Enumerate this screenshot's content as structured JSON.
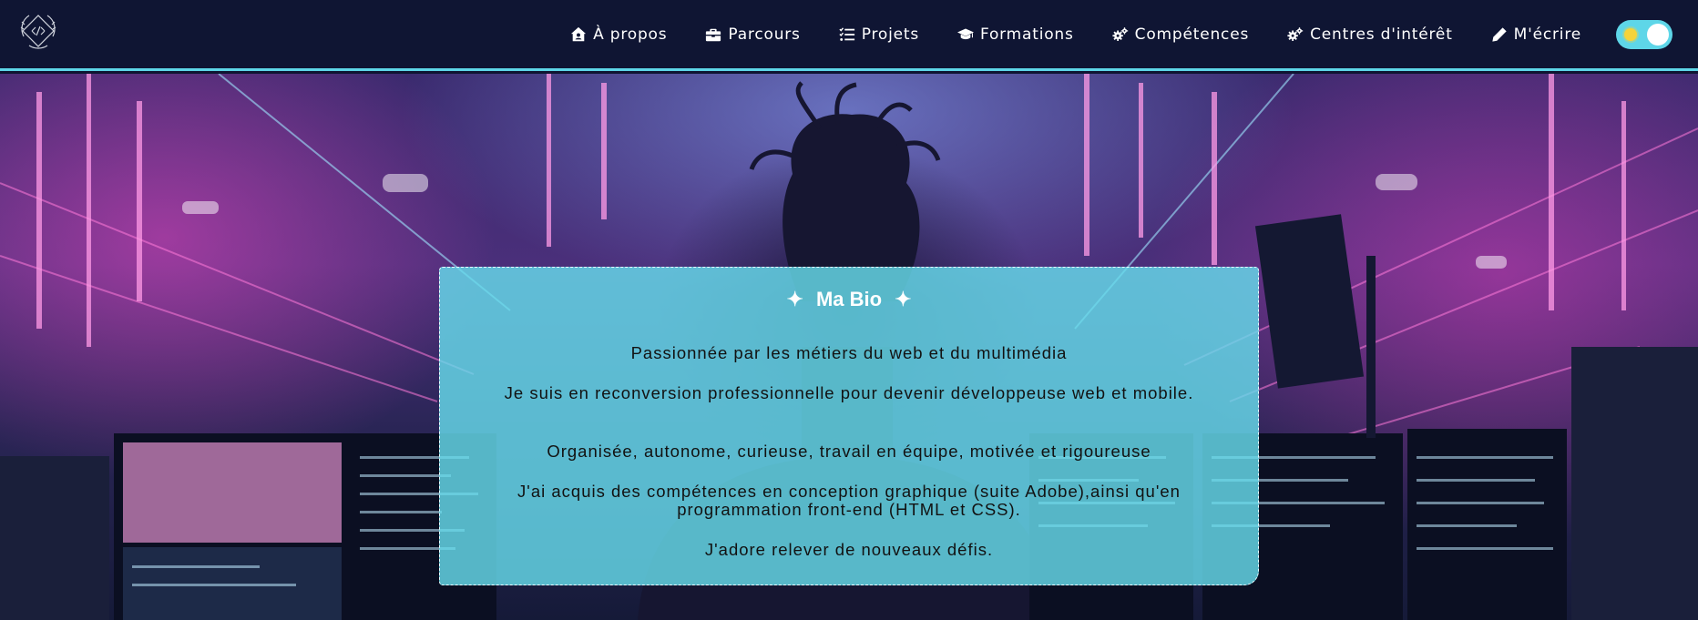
{
  "nav": {
    "items": [
      {
        "label": "À propos",
        "icon": "house-user-icon"
      },
      {
        "label": "Parcours",
        "icon": "briefcase-icon"
      },
      {
        "label": "Projets",
        "icon": "list-check-icon"
      },
      {
        "label": "Formations",
        "icon": "graduation-cap-icon"
      },
      {
        "label": "Compétences",
        "icon": "gears-icon"
      },
      {
        "label": "Centres d'intérêt",
        "icon": "gears-icon"
      },
      {
        "label": "M'écrire",
        "icon": "pencil-icon"
      }
    ],
    "theme_toggle": {
      "state": "light",
      "icon": "sun-icon"
    }
  },
  "bio": {
    "title": "Ma Bio",
    "title_decoration": "✦",
    "paragraphs": [
      "Passionnée par les métiers du web et du multimédia",
      "Je suis en reconversion professionnelle pour devenir développeuse web et mobile.",
      "Organisée, autonome, curieuse, travail en équipe, motivée et rigoureuse",
      "J'ai acquis des compétences en conception graphique (suite Adobe),ainsi qu'en programmation front-end (HTML et CSS).",
      "J'adore relever de nouveaux défis."
    ]
  },
  "colors": {
    "navbar_bg": "#0f1533",
    "accent_cyan": "#5ed6e8",
    "card_bg": "#66dcec",
    "neon_pink": "#e046be"
  }
}
